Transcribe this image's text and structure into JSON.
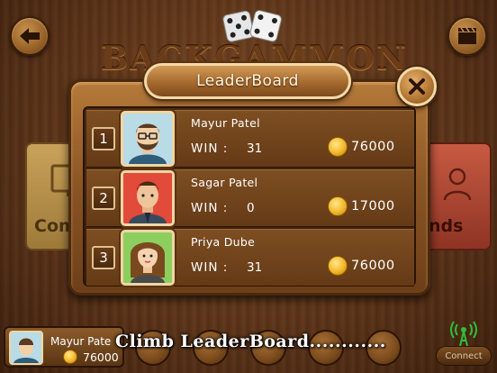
{
  "header": {
    "game_title": "BACKGAMMON"
  },
  "side_tiles": {
    "left_label": "Com",
    "right_label": "nds"
  },
  "leaderboard": {
    "title": "LeaderBoard",
    "win_label": "WIN :",
    "rows": [
      {
        "rank": "1",
        "name": "Mayur Patel",
        "wins": "31",
        "coins": "76000"
      },
      {
        "rank": "2",
        "name": "Sagar Patel",
        "wins": "0",
        "coins": "17000"
      },
      {
        "rank": "3",
        "name": "Priya Dube",
        "wins": "31",
        "coins": "76000"
      }
    ]
  },
  "me": {
    "name": "Mayur Pate",
    "coins": "76000"
  },
  "caption": "Climb LeaderBoard............",
  "connect_label": "Connect",
  "colors": {
    "wood_dark": "#4a2a0e",
    "wood_mid": "#8a5424",
    "gold": "#f4b72a",
    "connect_green": "#2fbf3a"
  },
  "icons": [
    "back-arrow-icon",
    "video-icon",
    "dice-icon",
    "close-icon",
    "coin-icon",
    "monitor-icon",
    "friends-icon",
    "antenna-icon"
  ]
}
